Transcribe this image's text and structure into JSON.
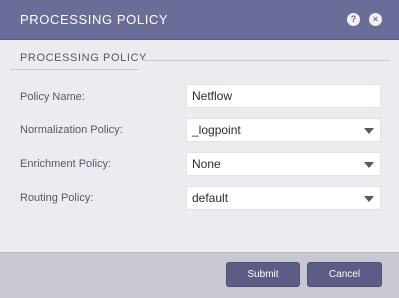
{
  "dialog": {
    "title": "PROCESSING POLICY",
    "help_icon": "?",
    "close_icon": "×"
  },
  "section": {
    "title": "PROCESSING POLICY"
  },
  "fields": {
    "policy_name": {
      "label": "Policy Name:",
      "value": "Netflow"
    },
    "normalization_policy": {
      "label": "Normalization Policy:",
      "value": "_logpoint"
    },
    "enrichment_policy": {
      "label": "Enrichment Policy:",
      "value": "None"
    },
    "routing_policy": {
      "label": "Routing Policy:",
      "value": "default"
    }
  },
  "footer": {
    "submit_label": "Submit",
    "cancel_label": "Cancel"
  },
  "colors": {
    "titlebar": "#6b6d99",
    "button": "#5b5d86",
    "footer": "#c8c8d2"
  },
  "icons": [
    "help-icon",
    "close-icon",
    "dropdown-caret-icon"
  ]
}
